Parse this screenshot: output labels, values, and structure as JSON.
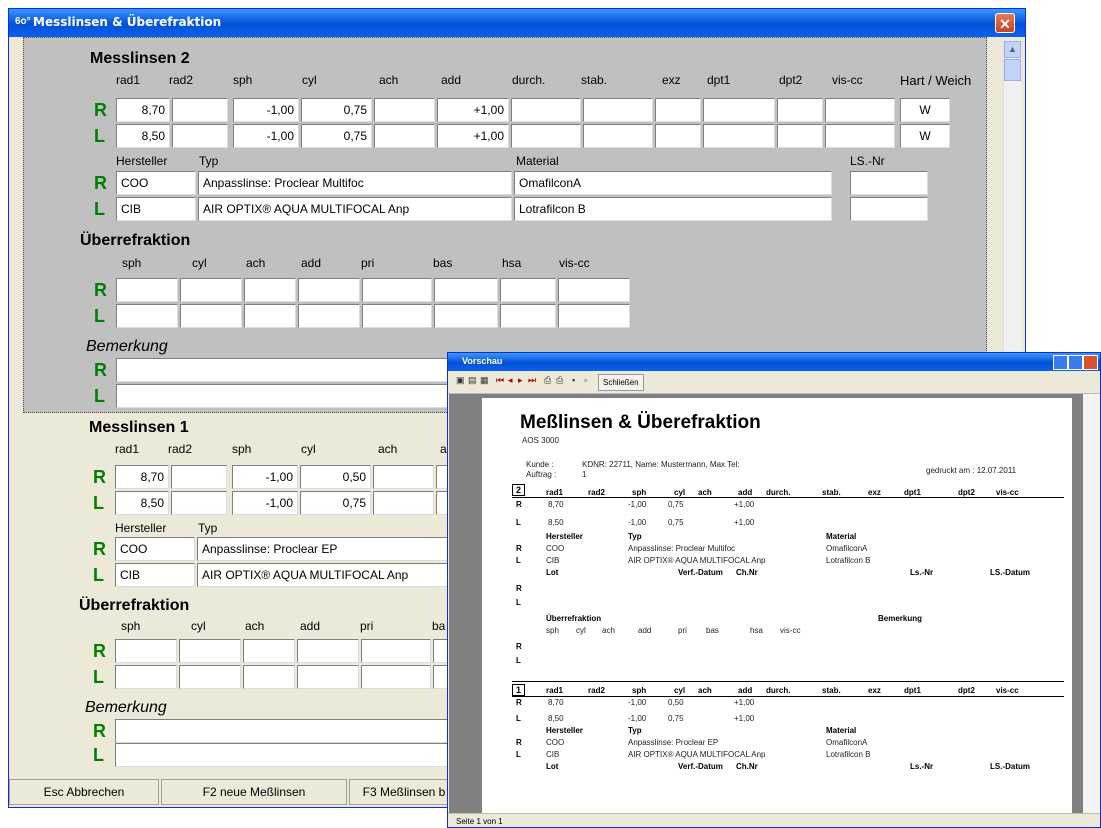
{
  "main": {
    "title": "Messlinsen & Überefraktion",
    "title_icon": "6o°",
    "close": "✕",
    "sec2": {
      "title": "Messlinsen  2",
      "cols": [
        "rad1",
        "rad2",
        "sph",
        "cyl",
        "ach",
        "add",
        "durch.",
        "stab.",
        "exz",
        "dpt1",
        "dpt2",
        "vis-cc",
        "Hart / Weich"
      ],
      "rowR": {
        "label": "R",
        "rad1": "8,70",
        "sph": "-1,00",
        "cyl": "0,75",
        "add": "+1,00",
        "hw": "W"
      },
      "rowL": {
        "label": "L",
        "rad1": "8,50",
        "sph": "-1,00",
        "cyl": "0,75",
        "add": "+1,00",
        "hw": "W"
      },
      "hersteller_label": "Hersteller",
      "typ_label": "Typ",
      "material_label": "Material",
      "lsnr_label": "LS.-Nr",
      "R": {
        "label": "R",
        "hersteller": "COO",
        "typ": "Anpasslinse: Proclear Multifoc",
        "material": "OmafilconA"
      },
      "L": {
        "label": "L",
        "hersteller": "CIB",
        "typ": "AIR OPTIX® AQUA MULTIFOCAL Anp",
        "material": "Lotrafilcon B"
      }
    },
    "ueber2": {
      "title": "Überrefraktion",
      "cols": [
        "sph",
        "cyl",
        "ach",
        "add",
        "pri",
        "bas",
        "hsa",
        "vis-cc"
      ],
      "R": "R",
      "L": "L"
    },
    "bem2": {
      "title": "Bemerkung",
      "R": "R",
      "L": "L"
    },
    "sec1": {
      "title": "Messlinsen  1",
      "cols": [
        "rad1",
        "rad2",
        "sph",
        "cyl",
        "ach",
        "a"
      ],
      "rowR": {
        "label": "R",
        "rad1": "8,70",
        "sph": "-1,00",
        "cyl": "0,50"
      },
      "rowL": {
        "label": "L",
        "rad1": "8,50",
        "sph": "-1,00",
        "cyl": "0,75"
      },
      "hersteller_label": "Hersteller",
      "typ_label": "Typ",
      "R": {
        "label": "R",
        "hersteller": "COO",
        "typ": "Anpasslinse: Proclear EP"
      },
      "L": {
        "label": "L",
        "hersteller": "CIB",
        "typ": "AIR OPTIX® AQUA MULTIFOCAL Anp"
      }
    },
    "ueber1": {
      "title": "Überrefraktion",
      "cols": [
        "sph",
        "cyl",
        "ach",
        "add",
        "pri",
        "ba"
      ],
      "R": "R",
      "L": "L"
    },
    "bem1": {
      "title": "Bemerkung",
      "R": "R",
      "L": "L"
    },
    "buttons": {
      "esc": "Esc Abbrechen",
      "f2": "F2 neue Meßlinsen",
      "f3": "F3 Meßlinsen b"
    },
    "scroll_up": "▲"
  },
  "preview": {
    "title": "Vorschau",
    "close_btn": "Schließen",
    "status": "Seite 1 von 1",
    "doc": {
      "heading": "Meßlinsen & Überefraktion",
      "sub": "AOS 3000",
      "kunde_label": "Kunde :",
      "kunde_val": "KDNR: 22711, Name: Mustermann, Max Tel:",
      "auftrag_label": "Auftrag :",
      "auftrag_val": "1",
      "printed": "gedruckt am : 12.07.2011",
      "cols": [
        "rad1",
        "rad2",
        "sph",
        "cyl",
        "ach",
        "add",
        "durch.",
        "stab.",
        "exz",
        "dpt1",
        "dpt2",
        "vis-cc"
      ],
      "b2": {
        "num": "2",
        "R": {
          "l": "R",
          "rad1": "8,70",
          "sph": "-1,00",
          "cyl": "0,75",
          "add": "+1,00"
        },
        "L": {
          "l": "L",
          "rad1": "8,50",
          "sph": "-1,00",
          "cyl": "0,75",
          "add": "+1,00"
        },
        "hdr": {
          "hersteller": "Hersteller",
          "typ": "Typ",
          "material": "Material"
        },
        "hR": {
          "l": "R",
          "hersteller": "COO",
          "typ": "Anpasslinse: Proclear Multifoc",
          "material": "OmafilconA"
        },
        "hL": {
          "l": "L",
          "hersteller": "CIB",
          "typ": "AIR OPTIX® AQUA MULTIFOCAL Anp",
          "material": "Lotrafilcon B"
        },
        "lot": {
          "lot": "Lot",
          "verf": "Verf.-Datum",
          "chnr": "Ch.Nr",
          "lsnr": "Ls.-Nr",
          "lsdat": "LS.-Datum"
        },
        "lotR": "R",
        "lotL": "L",
        "ueber": "Überrefraktion",
        "bem": "Bemerkung",
        "ucols": [
          "sph",
          "cyl",
          "ach",
          "add",
          "pri",
          "bas",
          "hsa",
          "vis-cc"
        ],
        "uR": "R",
        "uL": "L"
      },
      "b1": {
        "num": "1",
        "R": {
          "l": "R",
          "rad1": "8,70",
          "sph": "-1,00",
          "cyl": "0,50",
          "add": "+1,00"
        },
        "L": {
          "l": "L",
          "rad1": "8,50",
          "sph": "-1,00",
          "cyl": "0,75",
          "add": "+1,00"
        },
        "hdr": {
          "hersteller": "Hersteller",
          "typ": "Typ",
          "material": "Material"
        },
        "hR": {
          "l": "R",
          "hersteller": "COO",
          "typ": "Anpasslinse: Proclear EP",
          "material": "OmafilconA"
        },
        "hL": {
          "l": "L",
          "hersteller": "CIB",
          "typ": "AIR OPTIX® AQUA MULTIFOCAL Anp",
          "material": "Lotrafilcon B"
        },
        "lot": {
          "lot": "Lot",
          "verf": "Verf.-Datum",
          "chnr": "Ch.Nr",
          "lsnr": "Ls.-Nr",
          "lsdat": "LS.-Datum"
        }
      }
    }
  }
}
